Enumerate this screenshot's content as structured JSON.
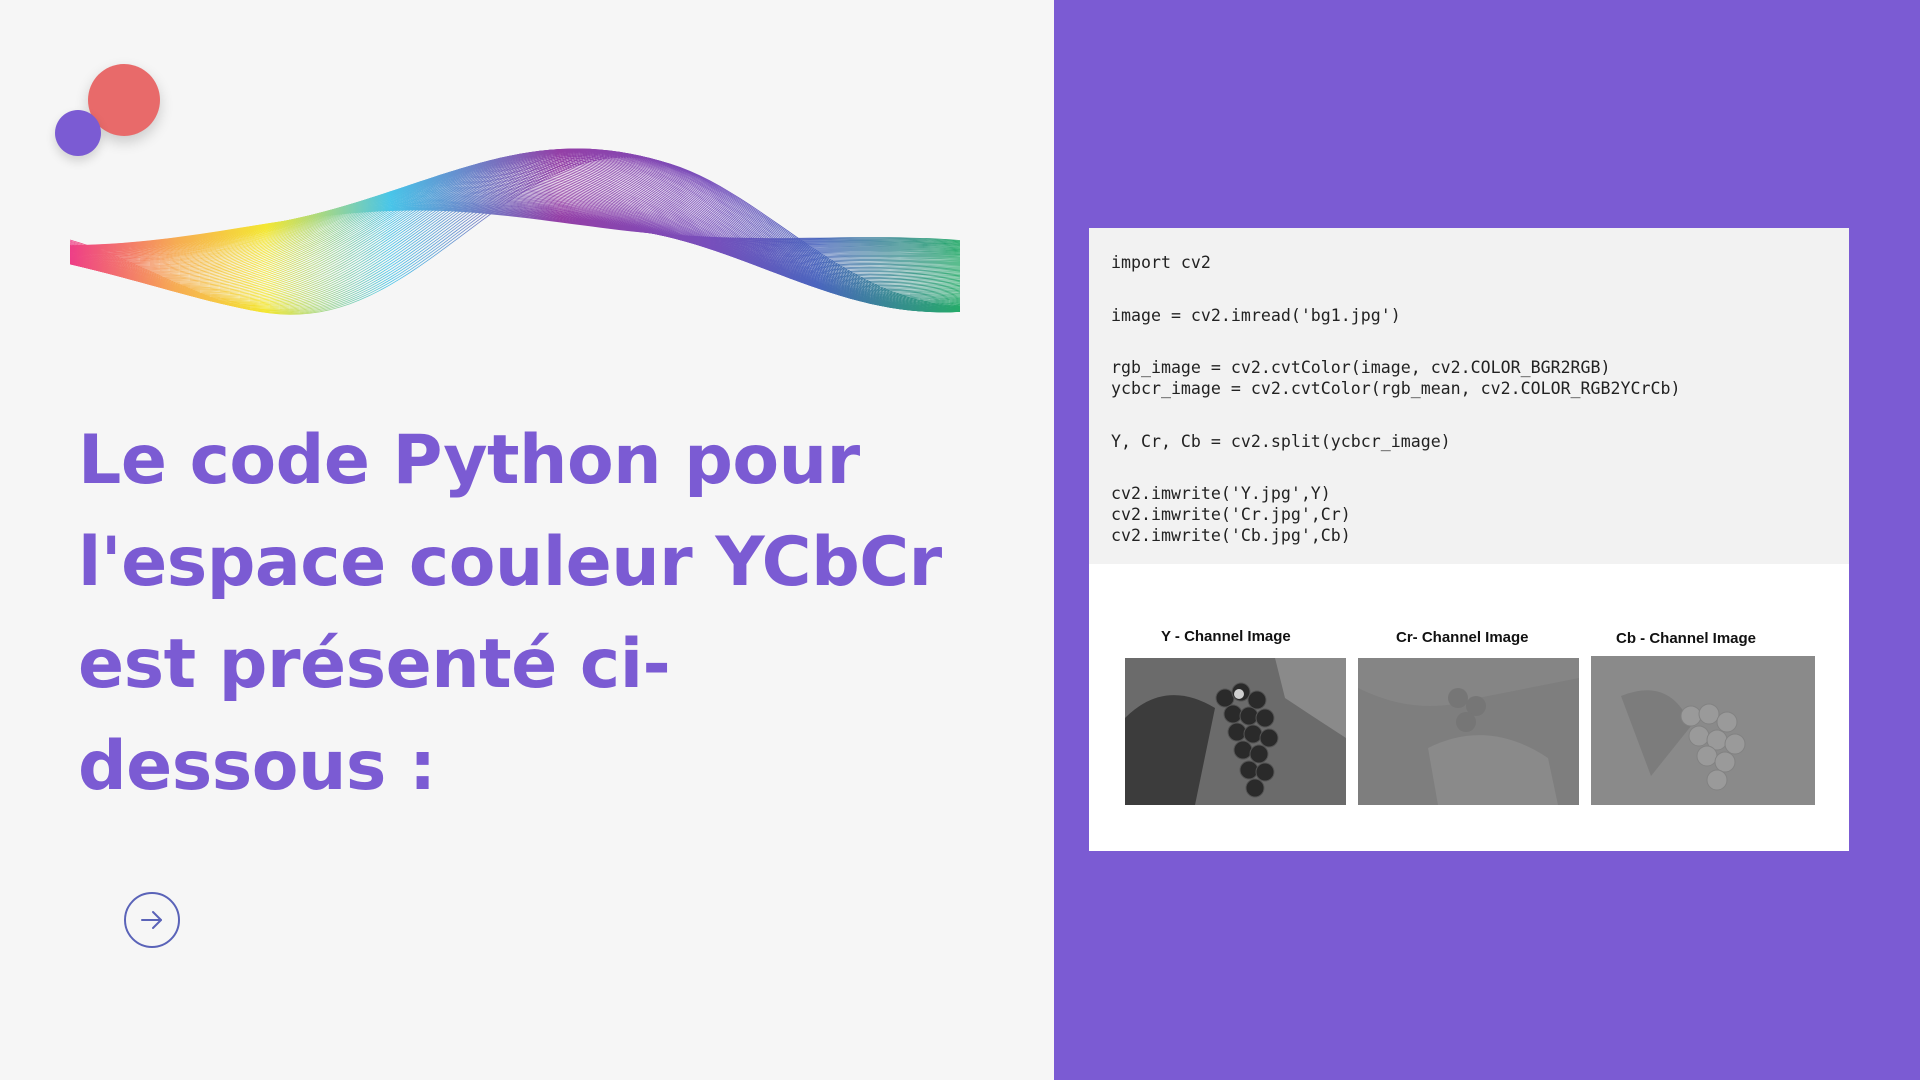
{
  "headline": {
    "line1": "Le code Python pour",
    "line2": "l'espace couleur YCbCr",
    "line3": "est présenté ci-dessous :"
  },
  "code": {
    "lines": [
      "import cv2",
      "image = cv2.imread('bg1.jpg')",
      "rgb_image = cv2.cvtColor(image, cv2.COLOR_BGR2RGB)",
      "ycbcr_image = cv2.cvtColor(rgb_mean, cv2.COLOR_RGB2YCrCb)",
      "Y, Cr, Cb = cv2.split(ycbcr_image)",
      "cv2.imwrite('Y.jpg',Y)",
      "cv2.imwrite('Cr.jpg',Cr)",
      "cv2.imwrite('Cb.jpg',Cb)"
    ]
  },
  "channels": [
    {
      "label": "Y - Channel Image",
      "tone": "#555555"
    },
    {
      "label": "Cr- Channel Image",
      "tone": "#7a7a7a"
    },
    {
      "label": "Cb - Channel Image",
      "tone": "#8a8a8a"
    }
  ],
  "icons": {
    "next": "arrow-right-icon"
  },
  "colors": {
    "accent": "#7b5bd3",
    "coral": "#e86a6a",
    "background": "#f6f6f6"
  }
}
